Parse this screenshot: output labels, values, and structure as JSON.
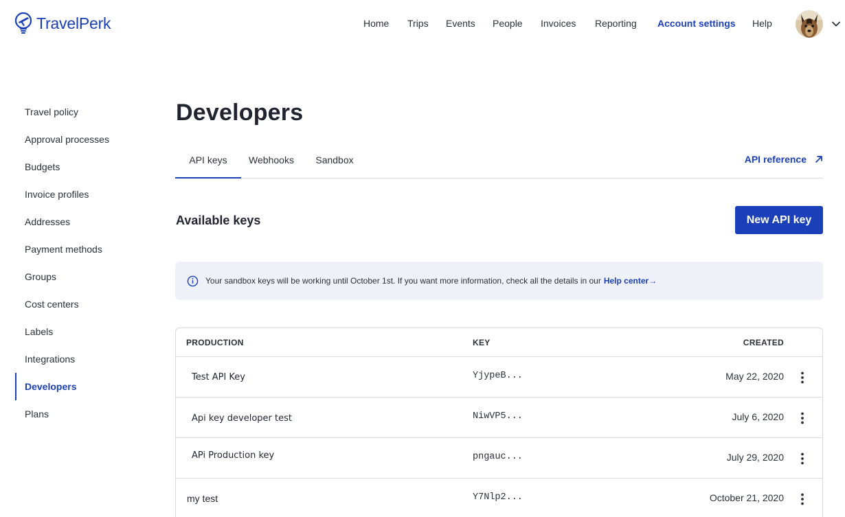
{
  "brand": {
    "name": "TravelPerk",
    "color": "#1a3fb8"
  },
  "nav": {
    "items": [
      {
        "label": "Home",
        "active": false
      },
      {
        "label": "Trips",
        "active": false
      },
      {
        "label": "Events",
        "active": false
      },
      {
        "label": "People",
        "active": false
      },
      {
        "label": "Invoices",
        "active": false
      },
      {
        "label": "Reporting",
        "active": false
      },
      {
        "label": "Account settings",
        "active": true
      },
      {
        "label": "Help",
        "active": false
      }
    ]
  },
  "sidebar": {
    "items": [
      {
        "label": "Travel policy"
      },
      {
        "label": "Approval processes"
      },
      {
        "label": "Budgets"
      },
      {
        "label": "Invoice profiles"
      },
      {
        "label": "Addresses"
      },
      {
        "label": "Payment methods"
      },
      {
        "label": "Groups"
      },
      {
        "label": "Cost centers"
      },
      {
        "label": "Labels"
      },
      {
        "label": "Integrations"
      },
      {
        "label": "Developers",
        "active": true
      },
      {
        "label": "Plans"
      }
    ]
  },
  "page": {
    "title": "Developers"
  },
  "tabs": {
    "items": [
      {
        "label": "API keys",
        "active": true
      },
      {
        "label": "Webhooks"
      },
      {
        "label": "Sandbox"
      }
    ],
    "api_reference": "API reference"
  },
  "keys": {
    "section_title": "Available keys",
    "new_button": "New API key",
    "banner": {
      "text": "Your sandbox keys will be working until October 1st. If you want more information, check all the details in our",
      "link": "Help center"
    },
    "table": {
      "headers": {
        "name": "PRODUCTION",
        "key": "KEY",
        "created": "CREATED"
      },
      "rows": [
        {
          "name": "Test API Key",
          "key": "YjypeB...",
          "created": "May 22, 2020"
        },
        {
          "name": "Api key developer test",
          "key": "NiwVP5...",
          "created": "July 6, 2020"
        },
        {
          "name": "APi Production key",
          "key": "pngauc...",
          "created": "July 29, 2020"
        },
        {
          "name": "my test",
          "key": "Y7Nlp2...",
          "created": "October 21, 2020"
        }
      ]
    }
  }
}
